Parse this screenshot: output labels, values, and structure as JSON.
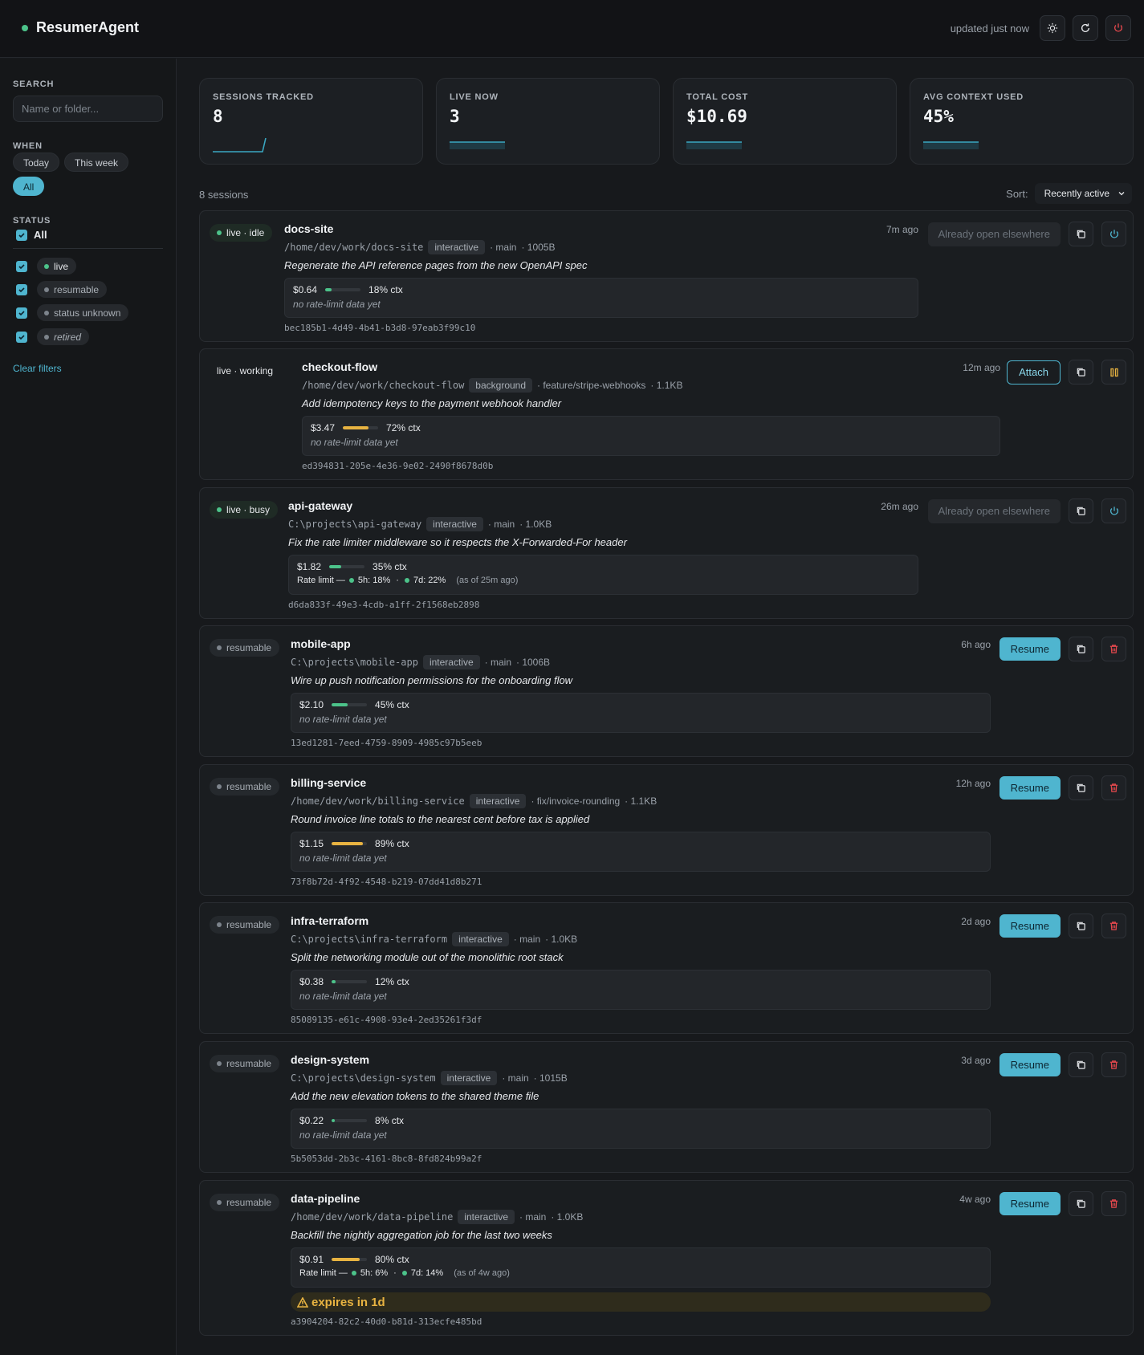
{
  "app": {
    "name": "ResumerAgent",
    "updated": "updated just now",
    "colors": {
      "accent": "#4fb5cf",
      "live": "#4cc38a",
      "warn": "#e8b341",
      "danger": "#e5484d"
    }
  },
  "sidebar": {
    "search_label": "SEARCH",
    "search_placeholder": "Name or folder...",
    "when_label": "WHEN",
    "when_options": [
      "Today",
      "This week",
      "All"
    ],
    "when_selected": "All",
    "status_label": "STATUS",
    "status_all": "All",
    "statuses": [
      "live",
      "resumable",
      "status unknown",
      "retired"
    ],
    "clear_filters": "Clear filters"
  },
  "stats": [
    {
      "label": "SESSIONS TRACKED",
      "value": "8"
    },
    {
      "label": "LIVE NOW",
      "value": "3"
    },
    {
      "label": "TOTAL COST",
      "value": "$10.69"
    },
    {
      "label": "AVG CONTEXT USED",
      "value": "45%"
    }
  ],
  "list": {
    "count": "8 sessions",
    "sort_label": "Sort:",
    "sort_value": "Recently active"
  },
  "sessions": [
    {
      "status": "live · idle",
      "name": "docs-site",
      "path": "/home/dev/work/docs-site",
      "mode": "interactive",
      "branch": "· main",
      "size": "· 1005B",
      "desc": "Regenerate the API reference pages from the new OpenAPI spec",
      "cost": "$0.64",
      "ctx": "18% ctx",
      "ctx_pct": 18,
      "rate": "no rate-limit data yet",
      "id": "bec185b1-4d49-4b41-b3d8-97eab3f99c10",
      "time": "7m ago",
      "action": "Already open elsewhere"
    },
    {
      "status": "live · working",
      "name": "checkout-flow",
      "path": "/home/dev/work/checkout-flow",
      "mode": "background",
      "branch": "· feature/stripe-webhooks",
      "size": "· 1.1KB",
      "desc": "Add idempotency keys to the payment webhook handler",
      "cost": "$3.47",
      "ctx": "72% ctx",
      "ctx_pct": 72,
      "rate": "no rate-limit data yet",
      "id": "ed394831-205e-4e36-9e02-2490f8678d0b",
      "time": "12m ago",
      "action": "Attach"
    },
    {
      "status": "live · busy",
      "name": "api-gateway",
      "path": "C:\\projects\\api-gateway",
      "mode": "interactive",
      "branch": "· main",
      "size": "· 1.0KB",
      "desc": "Fix the rate limiter middleware so it respects the X-Forwarded-For header",
      "cost": "$1.82",
      "ctx": "35% ctx",
      "ctx_pct": 35,
      "rate_label": "Rate limit —",
      "rate_5h": "5h: 18%",
      "rate_7d": "7d: 22%",
      "rate_asof": "(as of 25m ago)",
      "id": "d6da833f-49e3-4cdb-a1ff-2f1568eb2898",
      "time": "26m ago",
      "action": "Already open elsewhere"
    },
    {
      "status": "resumable",
      "name": "mobile-app",
      "path": "C:\\projects\\mobile-app",
      "mode": "interactive",
      "branch": "· main",
      "size": "· 1006B",
      "desc": "Wire up push notification permissions for the onboarding flow",
      "cost": "$2.10",
      "ctx": "45% ctx",
      "ctx_pct": 45,
      "rate": "no rate-limit data yet",
      "id": "13ed1281-7eed-4759-8909-4985c97b5eeb",
      "time": "6h ago",
      "action": "Resume"
    },
    {
      "status": "resumable",
      "name": "billing-service",
      "path": "/home/dev/work/billing-service",
      "mode": "interactive",
      "branch": "· fix/invoice-rounding",
      "size": "· 1.1KB",
      "desc": "Round invoice line totals to the nearest cent before tax is applied",
      "cost": "$1.15",
      "ctx": "89% ctx",
      "ctx_pct": 89,
      "rate": "no rate-limit data yet",
      "id": "73f8b72d-4f92-4548-b219-07dd41d8b271",
      "time": "12h ago",
      "action": "Resume"
    },
    {
      "status": "resumable",
      "name": "infra-terraform",
      "path": "C:\\projects\\infra-terraform",
      "mode": "interactive",
      "branch": "· main",
      "size": "· 1.0KB",
      "desc": "Split the networking module out of the monolithic root stack",
      "cost": "$0.38",
      "ctx": "12% ctx",
      "ctx_pct": 12,
      "rate": "no rate-limit data yet",
      "id": "85089135-e61c-4908-93e4-2ed35261f3df",
      "time": "2d ago",
      "action": "Resume"
    },
    {
      "status": "resumable",
      "name": "design-system",
      "path": "C:\\projects\\design-system",
      "mode": "interactive",
      "branch": "· main",
      "size": "· 1015B",
      "desc": "Add the new elevation tokens to the shared theme file",
      "cost": "$0.22",
      "ctx": "8% ctx",
      "ctx_pct": 8,
      "rate": "no rate-limit data yet",
      "id": "5b5053dd-2b3c-4161-8bc8-8fd824b99a2f",
      "time": "3d ago",
      "action": "Resume"
    },
    {
      "status": "resumable",
      "name": "data-pipeline",
      "path": "/home/dev/work/data-pipeline",
      "mode": "interactive",
      "branch": "· main",
      "size": "· 1.0KB",
      "desc": "Backfill the nightly aggregation job for the last two weeks",
      "cost": "$0.91",
      "ctx": "80% ctx",
      "ctx_pct": 80,
      "rate_label": "Rate limit —",
      "rate_5h": "5h: 6%",
      "rate_7d": "7d: 14%",
      "rate_asof": "(as of 4w ago)",
      "expires": "expires in 1d",
      "id": "a3904204-82c2-40d0-b81d-313ecfe485bd",
      "time": "4w ago",
      "action": "Resume"
    }
  ]
}
